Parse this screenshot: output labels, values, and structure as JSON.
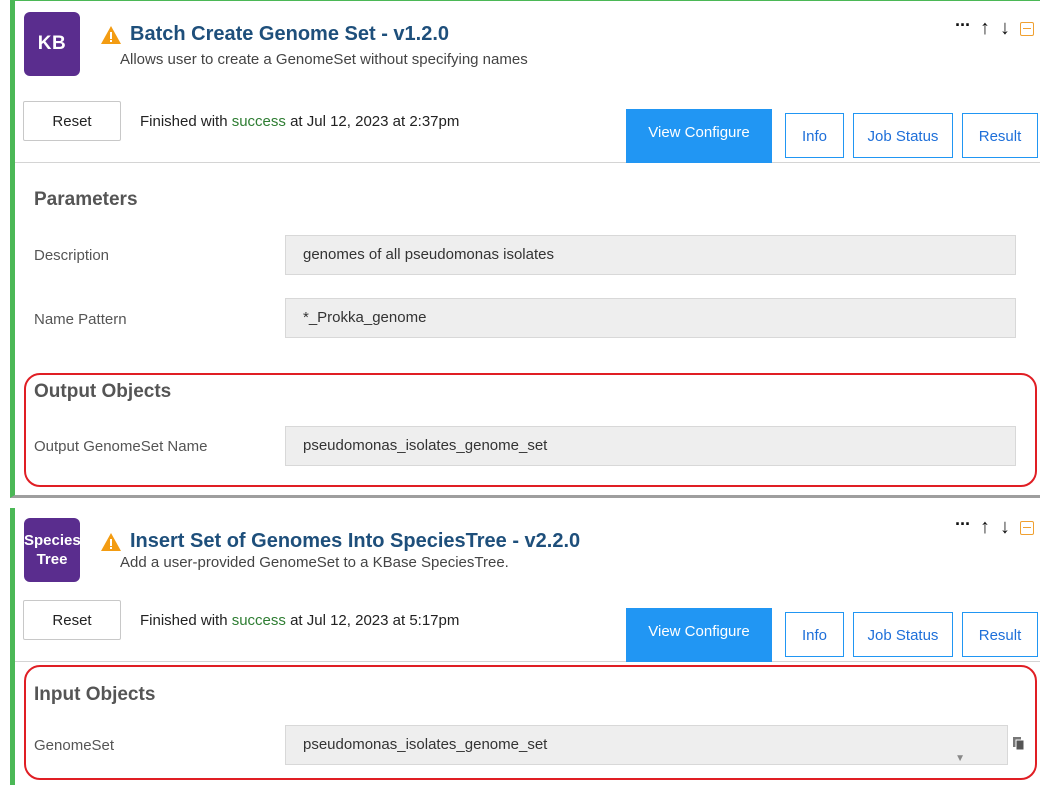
{
  "cell1": {
    "icon_text": "KB",
    "title": "Batch Create Genome Set - v1.2.0",
    "subtitle": "Allows user to create a GenomeSet without specifying names",
    "controls": {
      "more": "···",
      "up": "🡑",
      "down": "🡓"
    },
    "reset_label": "Reset",
    "status": {
      "prefix": "Finished with ",
      "word": "success",
      "suffix": " at Jul 12, 2023 at 2:37pm"
    },
    "tabs": {
      "view": "View Configure",
      "info": "Info",
      "job": "Job Status",
      "result": "Result"
    },
    "parameters_title": "Parameters",
    "fields": [
      {
        "label": "Description",
        "value": "genomes of all pseudomonas isolates"
      },
      {
        "label": "Name Pattern",
        "value": "*_Prokka_genome"
      }
    ],
    "output_title": "Output Objects",
    "output_field": {
      "label": "Output GenomeSet Name",
      "value": "pseudomonas_isolates_genome_set"
    }
  },
  "cell2": {
    "icon_line1": "Species",
    "icon_line2": "Tree",
    "title": "Insert Set of Genomes Into SpeciesTree - v2.2.0",
    "subtitle": "Add a user-provided GenomeSet to a KBase SpeciesTree.",
    "reset_label": "Reset",
    "status": {
      "prefix": "Finished with ",
      "word": "success",
      "suffix": " at Jul 12, 2023 at 5:17pm"
    },
    "tabs": {
      "view": "View Configure",
      "info": "Info",
      "job": "Job Status",
      "result": "Result"
    },
    "input_title": "Input Objects",
    "input_field": {
      "label": "GenomeSet",
      "value": "pseudomonas_isolates_genome_set"
    }
  },
  "colors": {
    "accent_blue": "#2196f3",
    "title_navy": "#1e4f7b",
    "app_purple": "#5a2d8e",
    "cell_green": "#4bb856",
    "highlight_red": "#e01e24",
    "warning_orange": "#f39c12"
  }
}
